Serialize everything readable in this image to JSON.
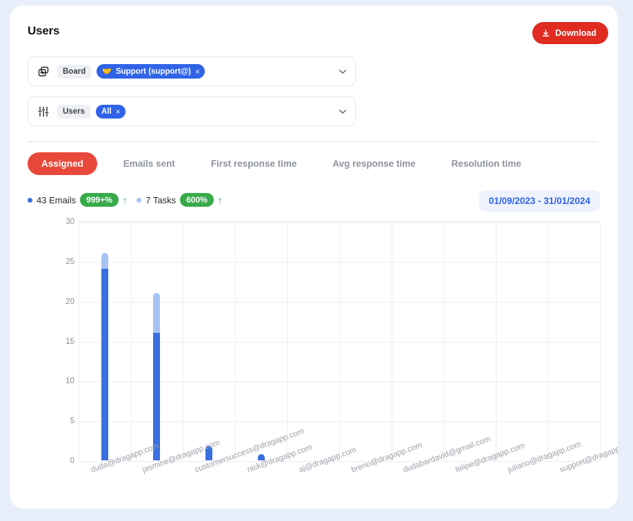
{
  "header": {
    "title": "Users",
    "download_label": "Download",
    "download_icon": "download-icon",
    "download_color": "#e02b20"
  },
  "filters": [
    {
      "icon": "boards-icon",
      "label": "Board",
      "chip_emoji": "🤝",
      "chip_text": "Support (support@)",
      "chip_remove": "×",
      "chevron": "⌄"
    },
    {
      "icon": "sliders-icon",
      "label": "Users",
      "chip_emoji": "",
      "chip_text": "All",
      "chip_remove": "×",
      "chevron": "⌄"
    }
  ],
  "tabs": [
    {
      "label": "Assigned",
      "active": true
    },
    {
      "label": "Emails sent",
      "active": false
    },
    {
      "label": "First response time",
      "active": false
    },
    {
      "label": "Avg response time",
      "active": false
    },
    {
      "label": "Resolution time",
      "active": false
    }
  ],
  "legend": [
    {
      "label": "43 Emails",
      "badge": "999+%",
      "arrow": "↑",
      "color": "#3a6fe0",
      "badge_color": "#37ab4a"
    },
    {
      "label": "7 Tasks",
      "badge": "600%",
      "arrow": "↑",
      "color": "#a7c3f5",
      "badge_color": "#37ab4a"
    }
  ],
  "date_range": "01/09/2023 - 31/01/2024",
  "chart_data": {
    "type": "bar",
    "stacked": true,
    "title": "",
    "xlabel": "",
    "ylabel": "",
    "ylim": [
      0,
      30
    ],
    "yticks": [
      0,
      5,
      10,
      15,
      20,
      25,
      30
    ],
    "grid": true,
    "legend_position": "top-left",
    "categories": [
      "duda@dragapp.com",
      "jasmine@dragapp.com",
      "customersuccess@dragapp.com",
      "nick@dragapp.com",
      "aj@dragapp.com",
      "breno@dragapp.com",
      "dudabardavid@gmail.com",
      "felipe@dragapp.com",
      "juliano@dragapp.com",
      "support@dragapp.com"
    ],
    "series": [
      {
        "name": "Emails",
        "color": "#3a6fe0",
        "values": [
          24,
          16,
          1.8,
          0.8,
          0,
          0,
          0,
          0,
          0,
          0
        ]
      },
      {
        "name": "Tasks",
        "color": "#a7c3f5",
        "values": [
          2,
          5,
          0,
          0,
          0,
          0,
          0,
          0,
          0,
          0
        ]
      }
    ]
  }
}
